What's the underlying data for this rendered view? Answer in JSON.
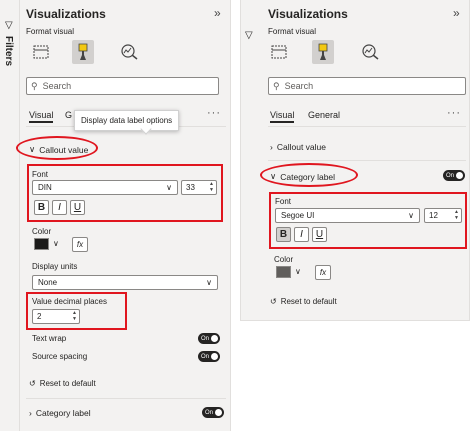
{
  "left": {
    "rail_label": "Filters",
    "title": "Visualizations",
    "subtitle": "Format visual",
    "search_placeholder": "Search",
    "tabs": [
      "Visual",
      "G"
    ],
    "tooltip": "Display data label options",
    "section": "Callout value",
    "font_label": "Font",
    "font_value": "DIN",
    "font_size": "33",
    "style_buttons": [
      "B",
      "I",
      "U"
    ],
    "color_label": "Color",
    "fx": "fx",
    "display_units_label": "Display units",
    "display_units_value": "None",
    "decimal_label": "Value decimal places",
    "decimal_value": "2",
    "text_wrap_label": "Text wrap",
    "text_wrap_toggle": "On",
    "source_spacing_label": "Source spacing",
    "source_spacing_toggle": "On",
    "reset": "Reset to default",
    "next_section": "Category label",
    "next_section_toggle": "On"
  },
  "right": {
    "title": "Visualizations",
    "subtitle": "Format visual",
    "search_placeholder": "Search",
    "tabs": [
      "Visual",
      "General"
    ],
    "callout_section": "Callout value",
    "section": "Category label",
    "section_toggle": "On",
    "font_label": "Font",
    "font_value": "Segoe UI",
    "font_size": "12",
    "style_buttons": [
      "B",
      "I",
      "U"
    ],
    "color_label": "Color",
    "fx": "fx",
    "reset": "Reset to default"
  },
  "colors": {
    "highlight": "#e0161f",
    "left_swatch": "#1b1a19",
    "right_swatch": "#605e5c",
    "accent": "#f2c811"
  },
  "icons": [
    "filter-icon",
    "double-chevron-icon",
    "table-format-icon",
    "paintbrush-format-icon",
    "analytics-icon",
    "search-icon",
    "more-dots-icon",
    "chevron-down-icon",
    "chevron-right-icon",
    "reset-icon"
  ]
}
